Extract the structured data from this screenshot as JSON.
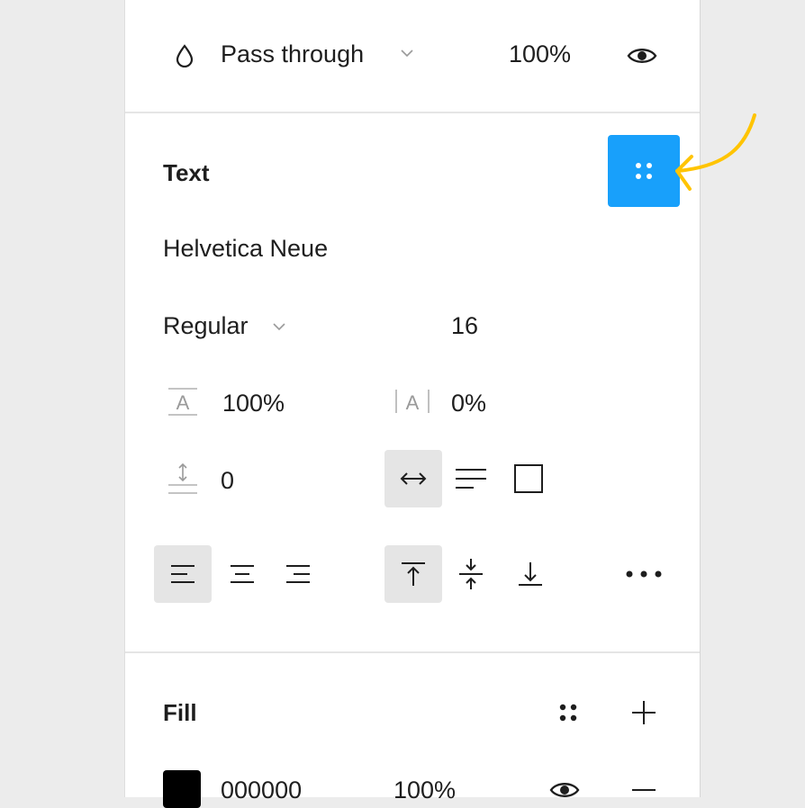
{
  "layer": {
    "blend_mode": "Pass through",
    "opacity": "100%"
  },
  "text": {
    "title": "Text",
    "font_family": "Helvetica Neue",
    "font_weight": "Regular",
    "font_size": "16",
    "line_height": "100%",
    "letter_spacing": "0%",
    "paragraph_spacing": "0"
  },
  "fill": {
    "title": "Fill",
    "color_hex": "000000",
    "opacity": "100%"
  },
  "colors": {
    "accent": "#18a0fb",
    "annotation_arrow": "#ffc400",
    "swatch": "#000000"
  },
  "icons": {
    "blend": "drop-icon",
    "visibility": "eye-icon",
    "styles": "grid-dots-icon",
    "more": "more-horizontal-icon",
    "add": "plus-icon",
    "remove": "minus-icon"
  }
}
